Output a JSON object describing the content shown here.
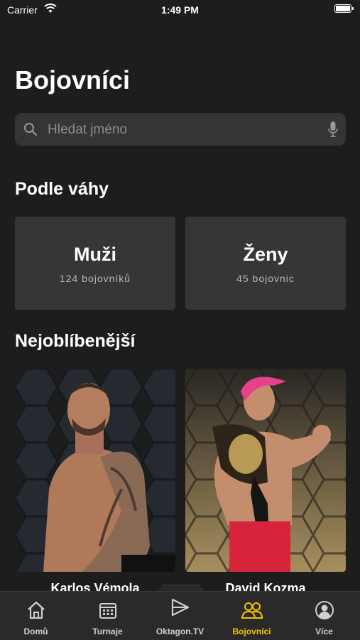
{
  "status_bar": {
    "carrier": "Carrier",
    "time": "1:49 PM"
  },
  "page": {
    "title": "Bojovníci"
  },
  "search": {
    "placeholder": "Hledat jméno"
  },
  "weight_section": {
    "title": "Podle váhy",
    "categories": [
      {
        "name": "Muži",
        "count": "124 bojovníků"
      },
      {
        "name": "Ženy",
        "count": "45 bojovnic"
      }
    ]
  },
  "popular_section": {
    "title": "Nejoblíbenější",
    "fighters": [
      {
        "name": "Karlos Vémola"
      },
      {
        "name": "David Kozma"
      }
    ]
  },
  "tab_bar": {
    "items": [
      {
        "label": "Domů",
        "icon": "home-icon"
      },
      {
        "label": "Turnaje",
        "icon": "calendar-icon"
      },
      {
        "label": "Oktagon.TV",
        "icon": "play-icon"
      },
      {
        "label": "Bojovníci",
        "icon": "people-icon",
        "active": true
      },
      {
        "label": "Více",
        "icon": "user-circle-icon"
      }
    ],
    "active_color": "#f5c400"
  }
}
